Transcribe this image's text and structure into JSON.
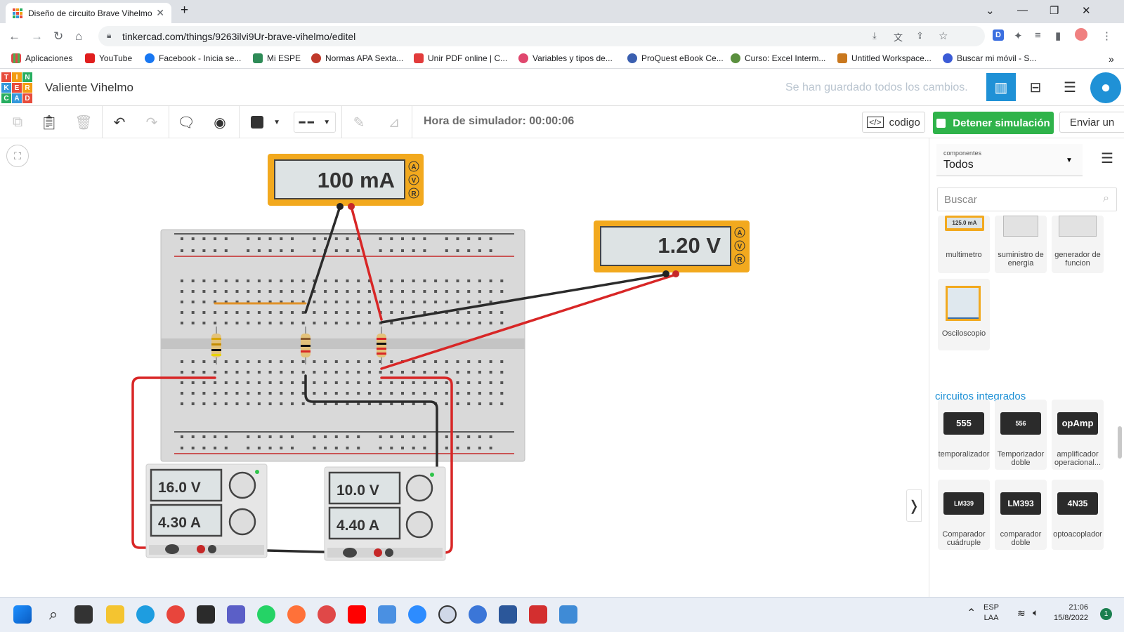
{
  "browser": {
    "tab_title": "Diseño de circuito Brave Vihelmo",
    "new_tab": "+",
    "url": "tinkercad.com/things/9263ilvi9Ur-brave-vihelmo/editel",
    "bookmarks": [
      {
        "label": "Aplicaciones",
        "color": "#e04848"
      },
      {
        "label": "YouTube",
        "color": "#e01e1e"
      },
      {
        "label": "Facebook - Inicia se...",
        "color": "#1877f2"
      },
      {
        "label": "Mi ESPE",
        "color": "#2e8b57"
      },
      {
        "label": "Normas APA Sexta...",
        "color": "#c0392b"
      },
      {
        "label": "Unir PDF online | C...",
        "color": "#e23b3b"
      },
      {
        "label": "Variables y tipos de...",
        "color": "#e0476e"
      },
      {
        "label": "ProQuest eBook Ce...",
        "color": "#3a5fb0"
      },
      {
        "label": "Curso: Excel Interm...",
        "color": "#5a8f3e"
      },
      {
        "label": "Untitled Workspace...",
        "color": "#c9781e"
      },
      {
        "label": "Buscar mi móvil - S...",
        "color": "#3b5bd6"
      }
    ]
  },
  "header": {
    "project_name": "Valiente Vihelmo",
    "saved_status": "Se han guardado todos los cambios.",
    "logo_letters": [
      "T",
      "I",
      "N",
      "K",
      "E",
      "R",
      "C",
      "A",
      "D"
    ]
  },
  "toolbar": {
    "sim_time": "Hora de simulador: 00:00:06",
    "code_label": "codigo",
    "stop_label": "Detener simulación",
    "send_label": "Enviar un"
  },
  "circuit": {
    "ammeter_reading": "100 mA",
    "voltmeter_reading": "1.20 V",
    "meter_modes": [
      "A",
      "V",
      "R"
    ],
    "supply1_voltage": "16.0 V",
    "supply1_current": "4.30 A",
    "supply2_voltage": "10.0 V",
    "supply2_current": "4.40 A"
  },
  "panel": {
    "components_label": "componentes",
    "components_value": "Todos",
    "search_placeholder": "Buscar",
    "instruments": [
      {
        "label": "multimetro",
        "display": "125.0 mA"
      },
      {
        "label": "suministro de energia",
        "display": ""
      },
      {
        "label": "generador de funcion",
        "display": ""
      },
      {
        "label": "Osciloscopio",
        "display": ""
      }
    ],
    "ic_header": "circuitos integrados",
    "ics": [
      {
        "label": "temporalizador",
        "chip": "555"
      },
      {
        "label": "Temporizador doble",
        "chip": "556"
      },
      {
        "label": "amplificador operacional...",
        "chip": "opAmp"
      },
      {
        "label": "Comparador cuádruple",
        "chip": "LM339"
      },
      {
        "label": "comparador doble",
        "chip": "LM393"
      },
      {
        "label": "optoacoplador",
        "chip": "4N35"
      }
    ]
  },
  "taskbar": {
    "lang": "ESP",
    "layout": "LAA",
    "time": "21:06",
    "date": "15/8/2022",
    "notifications": "1"
  }
}
